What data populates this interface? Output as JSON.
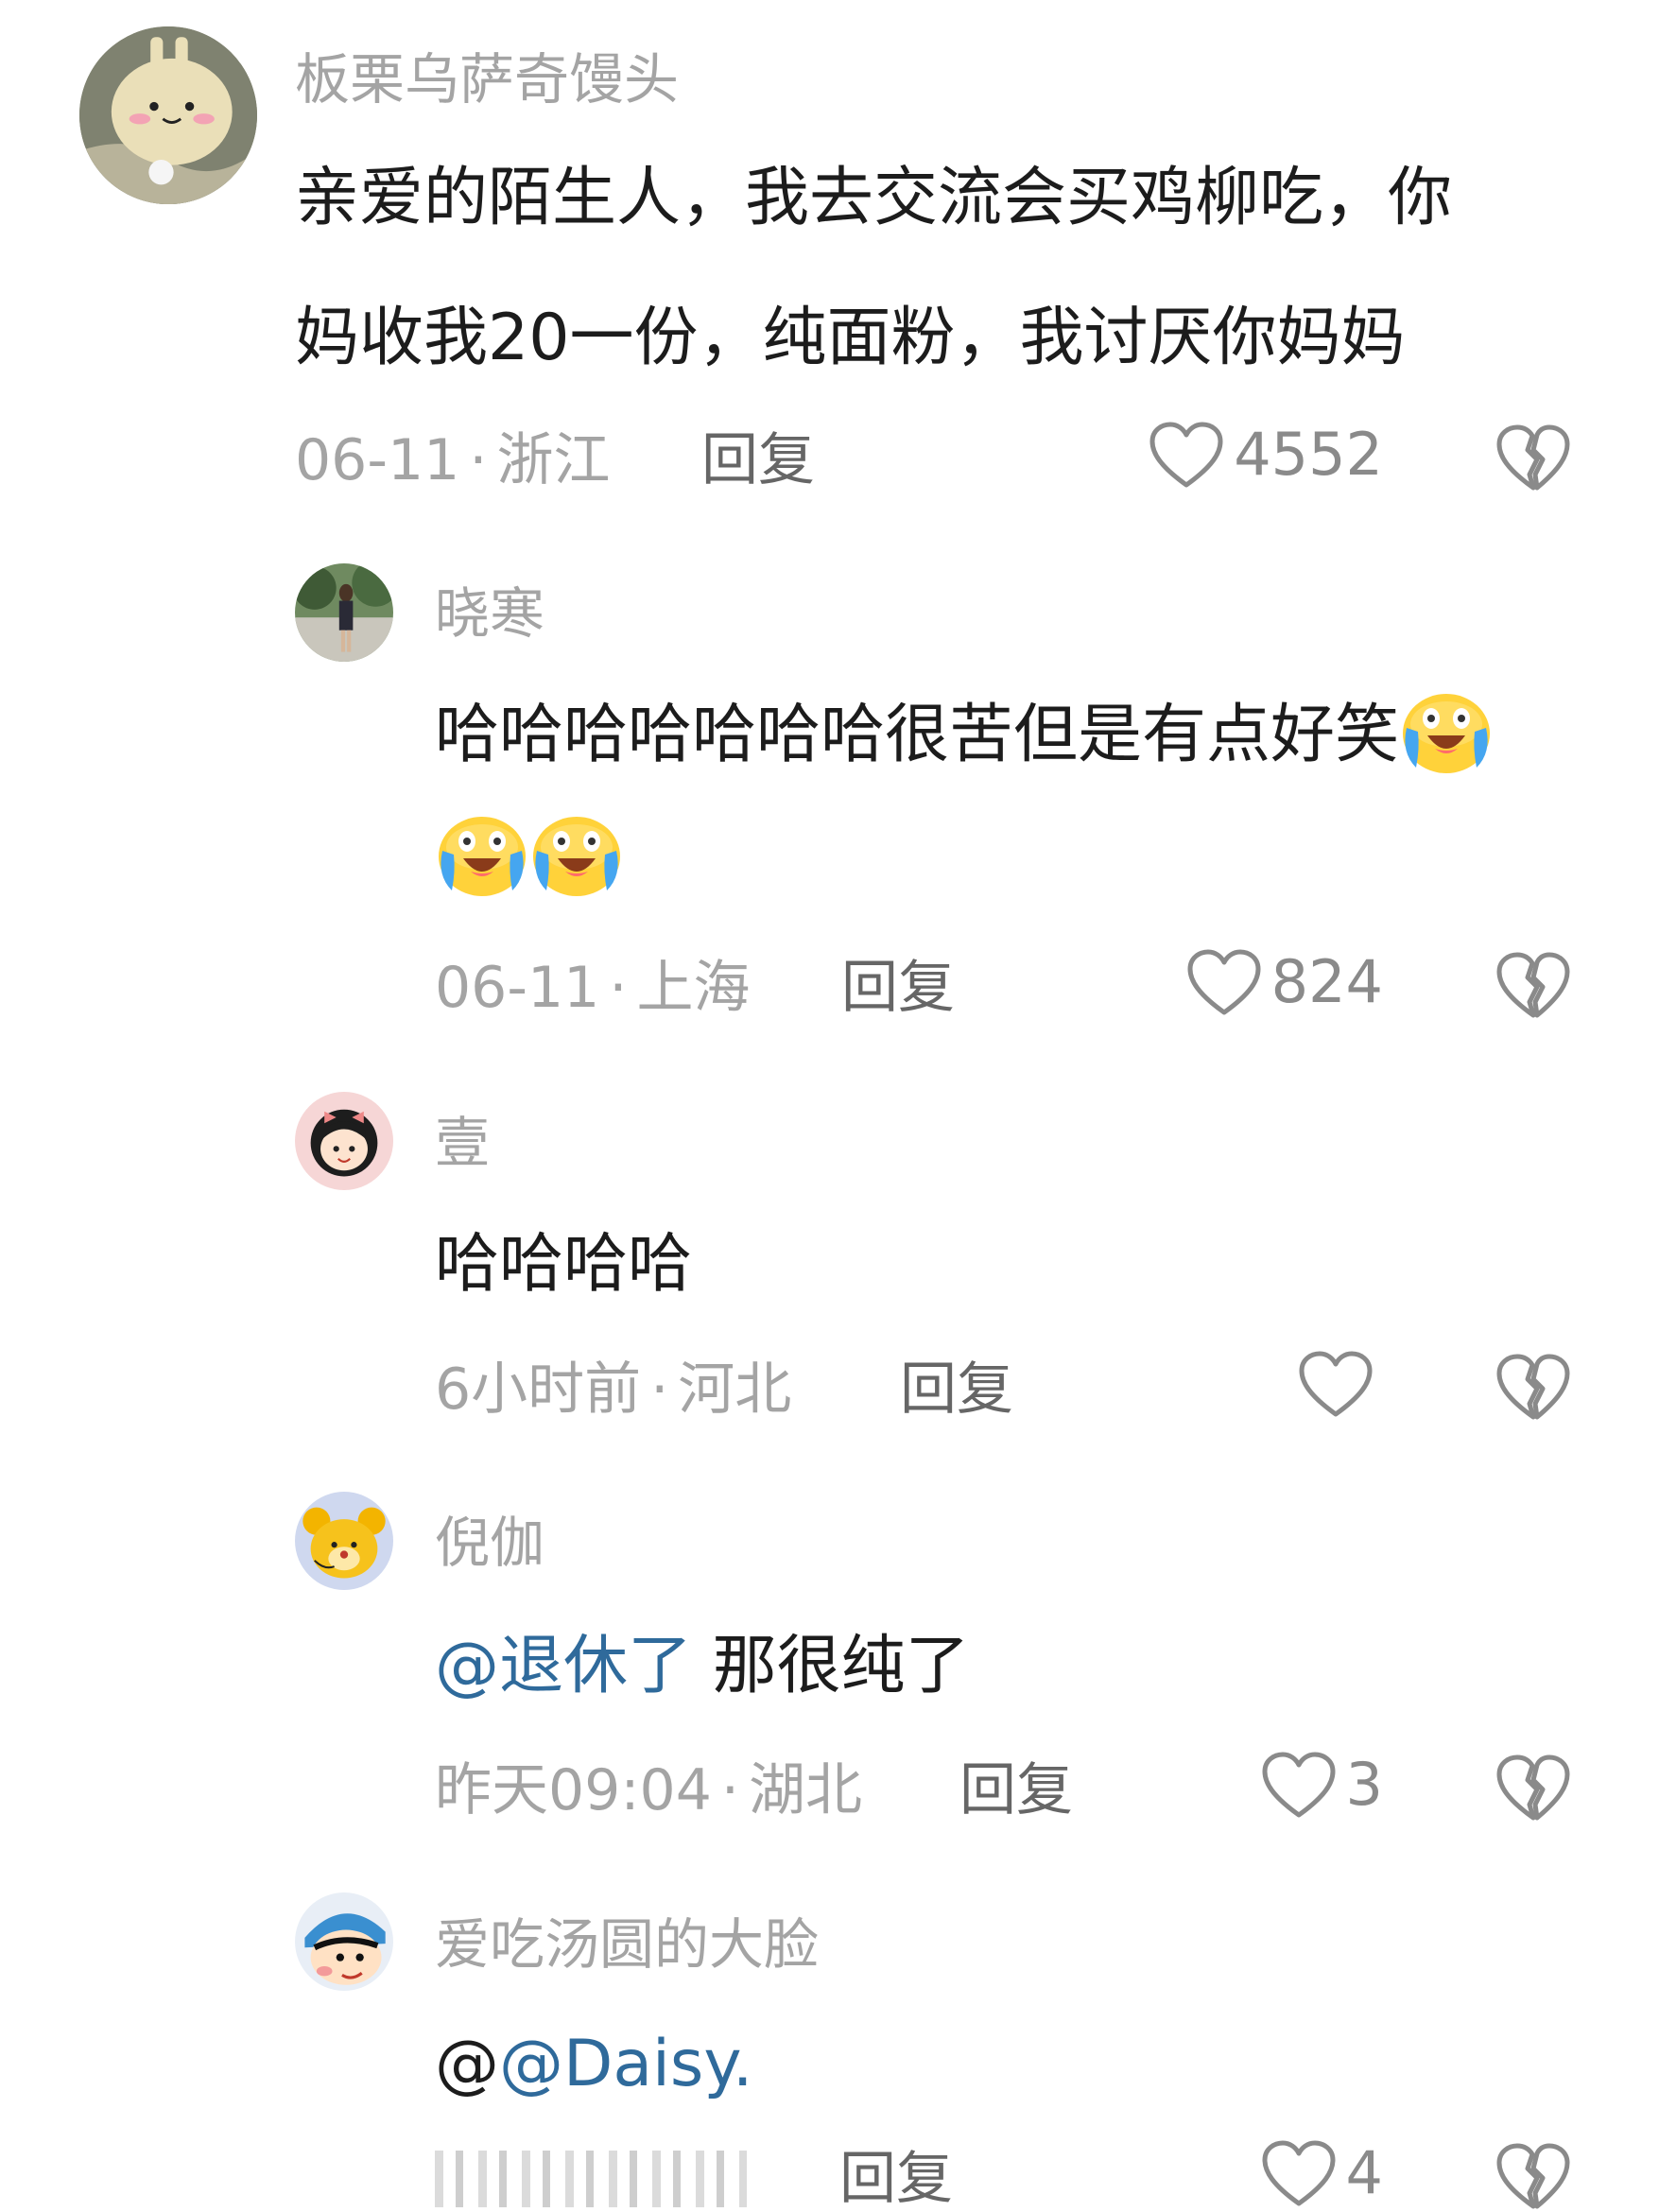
{
  "comments": [
    {
      "username": "板栗乌萨奇馒头",
      "text_line1": "亲爱的陌生人，我去交流会买鸡柳吃，你",
      "text_line2": "妈收我20一份，纯面粉，我讨厌你妈妈",
      "date": "06-11",
      "location": "浙江",
      "reply_label": "回复",
      "likes": "4552",
      "avatar_icon": "bunny-avatar"
    },
    {
      "username": "晓寒",
      "text_line1": "哈哈哈哈哈哈哈很苦但是有点好笑",
      "text_line2": "",
      "emoji": "crying-laughing-emoji",
      "date": "06-11",
      "location": "上海",
      "reply_label": "回复",
      "likes": "824",
      "avatar_icon": "photo-avatar"
    },
    {
      "username": "壹",
      "text_line1": "哈哈哈哈",
      "date": "6小时前",
      "location": "河北",
      "reply_label": "回复",
      "likes": "",
      "avatar_icon": "girl-avatar"
    },
    {
      "username": "倪伽",
      "mention": "@退休了",
      "text_line1": "那很纯了",
      "date": "昨天09:04",
      "location": "湖北",
      "reply_label": "回复",
      "likes": "3",
      "avatar_icon": "bear-avatar"
    },
    {
      "username": "爱吃汤圆的大脸",
      "prefix": "@",
      "mention": "@Daisy.",
      "reply_label": "回复",
      "likes": "4",
      "avatar_icon": "cartoon-boy-avatar"
    }
  ],
  "meta_separator": "·",
  "colors": {
    "username": "#a4a4a4",
    "text": "#1c1c1c",
    "mention": "#2f6a9b",
    "meta": "#a4a4a4"
  }
}
